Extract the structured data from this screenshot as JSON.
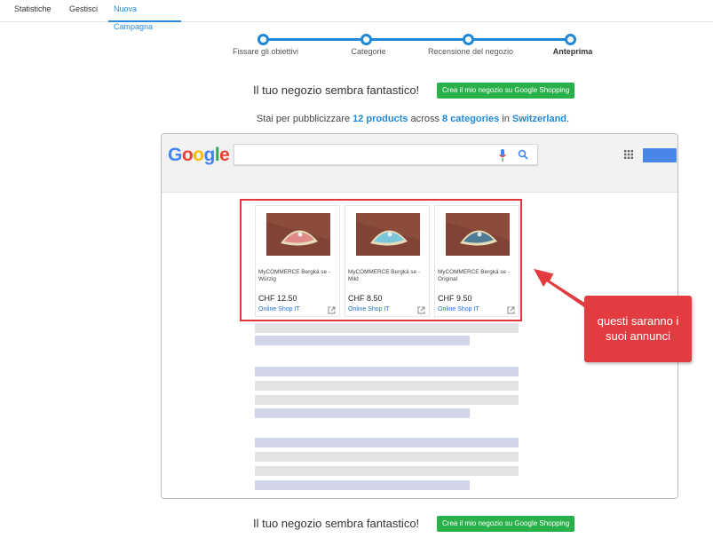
{
  "tabs": [
    {
      "label": "Statistiche"
    },
    {
      "label": "Gestisci"
    },
    {
      "label": "Nuova Campagna"
    }
  ],
  "stepper": {
    "steps": [
      {
        "label": "Fissare gli obiettivi"
      },
      {
        "label": "Categorie"
      },
      {
        "label": "Recensione del negozio"
      },
      {
        "label": "Anteprima"
      }
    ],
    "current_step": 4
  },
  "headline": {
    "text": "Il tuo negozio sembra fantastico!",
    "cta_label": "Crea il mio negozio su Google Shopping"
  },
  "summary": {
    "prefix": "Stai per pubblicizzare",
    "products": "12 products",
    "across": "across",
    "categories": "8 categories",
    "in": "in",
    "country": "Switzerland",
    "end": "."
  },
  "preview": {
    "logo": [
      "G",
      "o",
      "o",
      "g",
      "l",
      "e"
    ],
    "logo_colors": [
      "#4285f4",
      "#ea4335",
      "#fbbc05",
      "#4285f4",
      "#34a853",
      "#ea4335"
    ],
    "products": [
      {
        "title": "MyCOMMERCE Bergkä se - Würzig",
        "price": "CHF 12.50",
        "shop": "Online Shop IT",
        "label_color": "#e08a8a"
      },
      {
        "title": "MyCOMMERCE Bergkä se - Mild",
        "price": "CHF 8.50",
        "shop": "Online Shop IT",
        "label_color": "#7cc6dc"
      },
      {
        "title": "MyCOMMERCE Bergkä se - Original",
        "price": "CHF 9.50",
        "shop": "Online Shop IT",
        "label_color": "#4f7c95"
      }
    ]
  },
  "callout": {
    "line1": "questi saranno i",
    "line2": "suoi annunci"
  },
  "colors": {
    "accent": "#1e88d6",
    "cta": "#28b04a",
    "highlight": "#e0373f"
  }
}
